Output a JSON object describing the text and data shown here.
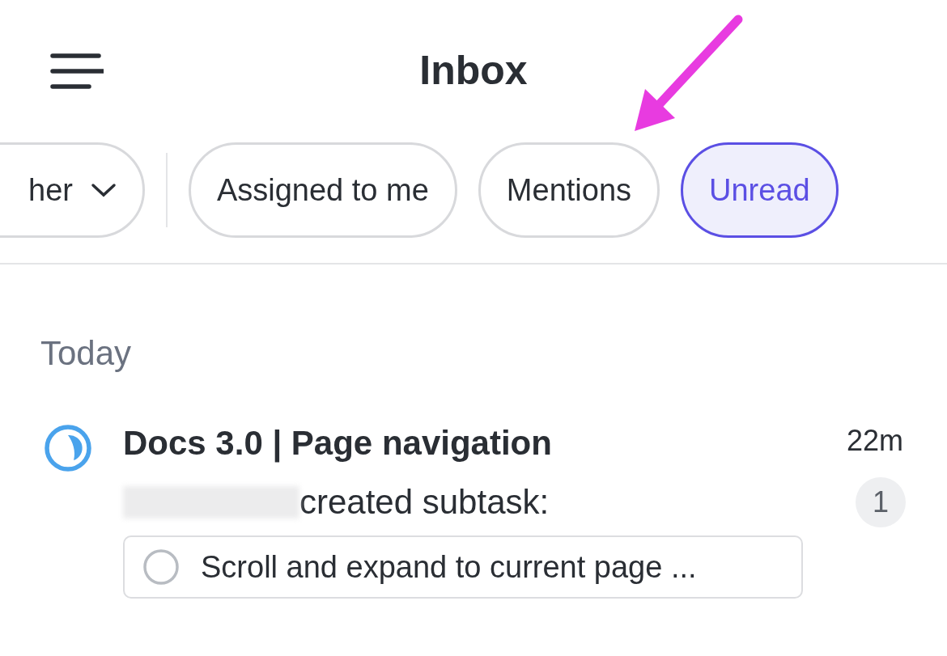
{
  "header": {
    "title": "Inbox"
  },
  "filters": [
    {
      "label": "her",
      "kind": "dropdown",
      "selected": false
    },
    {
      "label": "Assigned to me",
      "kind": "chip",
      "selected": false
    },
    {
      "label": "Mentions",
      "kind": "chip",
      "selected": false
    },
    {
      "label": "Unread",
      "kind": "chip",
      "selected": true
    }
  ],
  "section": "Today",
  "items": [
    {
      "title": "Docs 3.0 | Page navigation",
      "time": "22m",
      "count": "1",
      "action": "created subtask:",
      "subtask": "Scroll and expand to current page ..."
    }
  ]
}
